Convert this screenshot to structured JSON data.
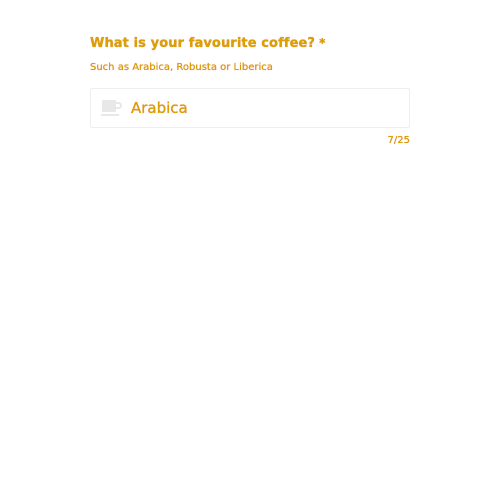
{
  "field": {
    "label": "What is your favourite coffee?",
    "required_marker": "*",
    "hint": "Such as Arabica, Robusta or Liberica",
    "icon": "coffee-cup-icon",
    "value": "Arabica",
    "counter": "7/25"
  },
  "colors": {
    "text": "#d9a200",
    "text_shadow": "#e23a00",
    "input_border": "#eeeeee",
    "icon": "#e8e8e8"
  }
}
